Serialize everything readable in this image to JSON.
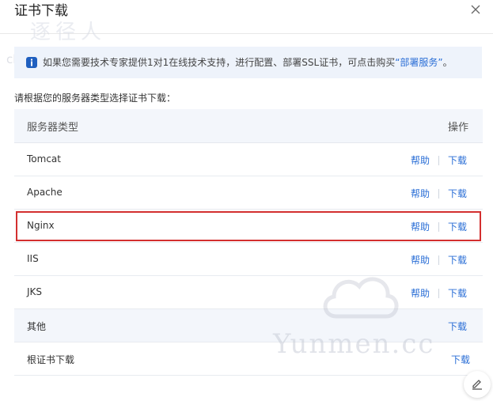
{
  "dialog": {
    "title": "证书下载"
  },
  "watermarks": {
    "top": "逐径人",
    "side": "chuhou",
    "bottom": "Yunmen.cc"
  },
  "notice": {
    "text": "如果您需要技术专家提供1对1在线技术支持，进行配置、部署SSL证书，可点击购买",
    "link": "“部署服务”",
    "suffix": "。"
  },
  "instruction": "请根据您的服务器类型选择证书下载：",
  "table": {
    "headers": {
      "type": "服务器类型",
      "action": "操作"
    },
    "rows": [
      {
        "name": "Tomcat",
        "help": "帮助",
        "download": "下载"
      },
      {
        "name": "Apache",
        "help": "帮助",
        "download": "下载"
      },
      {
        "name": "Nginx",
        "help": "帮助",
        "download": "下载"
      },
      {
        "name": "IIS",
        "help": "帮助",
        "download": "下载"
      },
      {
        "name": "JKS",
        "help": "帮助",
        "download": "下载"
      },
      {
        "name": "其他",
        "download": "下载"
      },
      {
        "name": "根证书下载",
        "download": "下载"
      }
    ]
  },
  "colors": {
    "link": "#2a6ed6",
    "highlight": "#d32f2f",
    "header_bg": "#f3f6fb",
    "notice_bg": "#eef3fb"
  },
  "icons": {
    "close": "close-icon",
    "info": "info-icon",
    "edit": "edit-pen-icon"
  }
}
